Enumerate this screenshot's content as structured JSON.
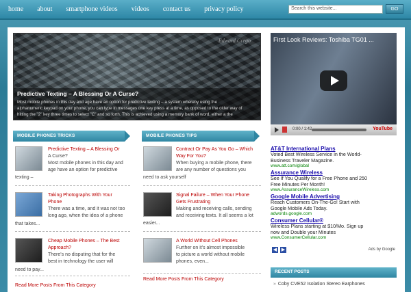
{
  "nav": {
    "items": [
      "home",
      "about",
      "smartphone videos",
      "videos",
      "contact us",
      "privacy policy"
    ]
  },
  "search": {
    "placeholder": "Search this website...",
    "button": "GO"
  },
  "slider": {
    "watermark": "Edward Grego",
    "title": "Predictive Texting – A Blessing Or A Curse?",
    "lines": [
      "Most mobile phones in this day and age have an option for predictive texting – a system whereby using the",
      "alphanumeric keypad on your phone, you can type in messages one key press at a time, as opposed to the older way of",
      "hitting the \"2\" key three times to select \"C\" and so forth. This is achieved using a memory bank of word, either a the"
    ]
  },
  "video": {
    "title": "First Look Reviews: Toshiba TG01 ...",
    "time": "0:00 / 1:42",
    "brand": "YouTube"
  },
  "left_column": {
    "header": "MOBILE PHONES TRICKS",
    "posts": [
      {
        "title": "Predictive Texting – A Blessing Or",
        "text": [
          "A Curse?",
          "Most mobile phones in this day and",
          "age have an option for predictive"
        ],
        "tail": "texting –"
      },
      {
        "title": "Taking Photographs With Your",
        "text": [
          "Phone",
          "There was a time, and it was not too",
          "long ago, when the idea of a phone"
        ],
        "tail": "that takes..."
      },
      {
        "title": "Cheap Mobile Phones – The Best",
        "text": [
          "Approach?",
          "There's no disputing that for the",
          "best in technology the user will"
        ],
        "tail": "need to pay..."
      }
    ],
    "more": "Read More Posts From This Category"
  },
  "mid_column": {
    "header": "MOBILE PHONES TIPS",
    "posts": [
      {
        "title": "Contract Or Pay As You Go – Which",
        "text": [
          "Way For You?",
          "When buying a mobile phone, there",
          "are any number of questions you"
        ],
        "tail": "need to ask yourself"
      },
      {
        "title": "Signal Failure – When Your Phone",
        "text": [
          "Gets Frustrating",
          "Making and receiving calls, sending",
          "and receiving texts. It all seems a lot"
        ],
        "tail": "easier..."
      },
      {
        "title": "A World Without Cell Phones",
        "text": [
          "Further on it's almost impossible",
          "to picture a world without mobile",
          "phones, even..."
        ],
        "tail": ""
      }
    ],
    "more": "Read More Posts From This Category"
  },
  "ads": [
    {
      "title": "AT&T International Plans",
      "lines": [
        "Voted Best Wireless Service in the World-",
        "Business Traveler Magazine."
      ],
      "url": "www.att.com/global"
    },
    {
      "title": "Assurance Wireless",
      "lines": [
        "See If You Qualify for a Free Phone and 250",
        "Free Minutes Per Month!"
      ],
      "url": "www.AssuranceWireless.com"
    },
    {
      "title": "Google Mobile Advertising",
      "lines": [
        "Reach Customers On-The-Go! Start with",
        "Google Mobile Ads Today."
      ],
      "url": "adwords.google.com"
    },
    {
      "title": "Consumer Cellular®",
      "lines": [
        "Wireless Plans starting at $10/Mo. Sign up",
        "now and Double your Minutes"
      ],
      "url": "www.ConsumerCellular.com"
    }
  ],
  "ads_footer": {
    "prev": "◀",
    "next": "▶",
    "label": "Ads by Google"
  },
  "recent": {
    "header": "RECENT POSTS",
    "items": [
      "Coby CVE52 Isolation Stereo Earphones"
    ]
  }
}
